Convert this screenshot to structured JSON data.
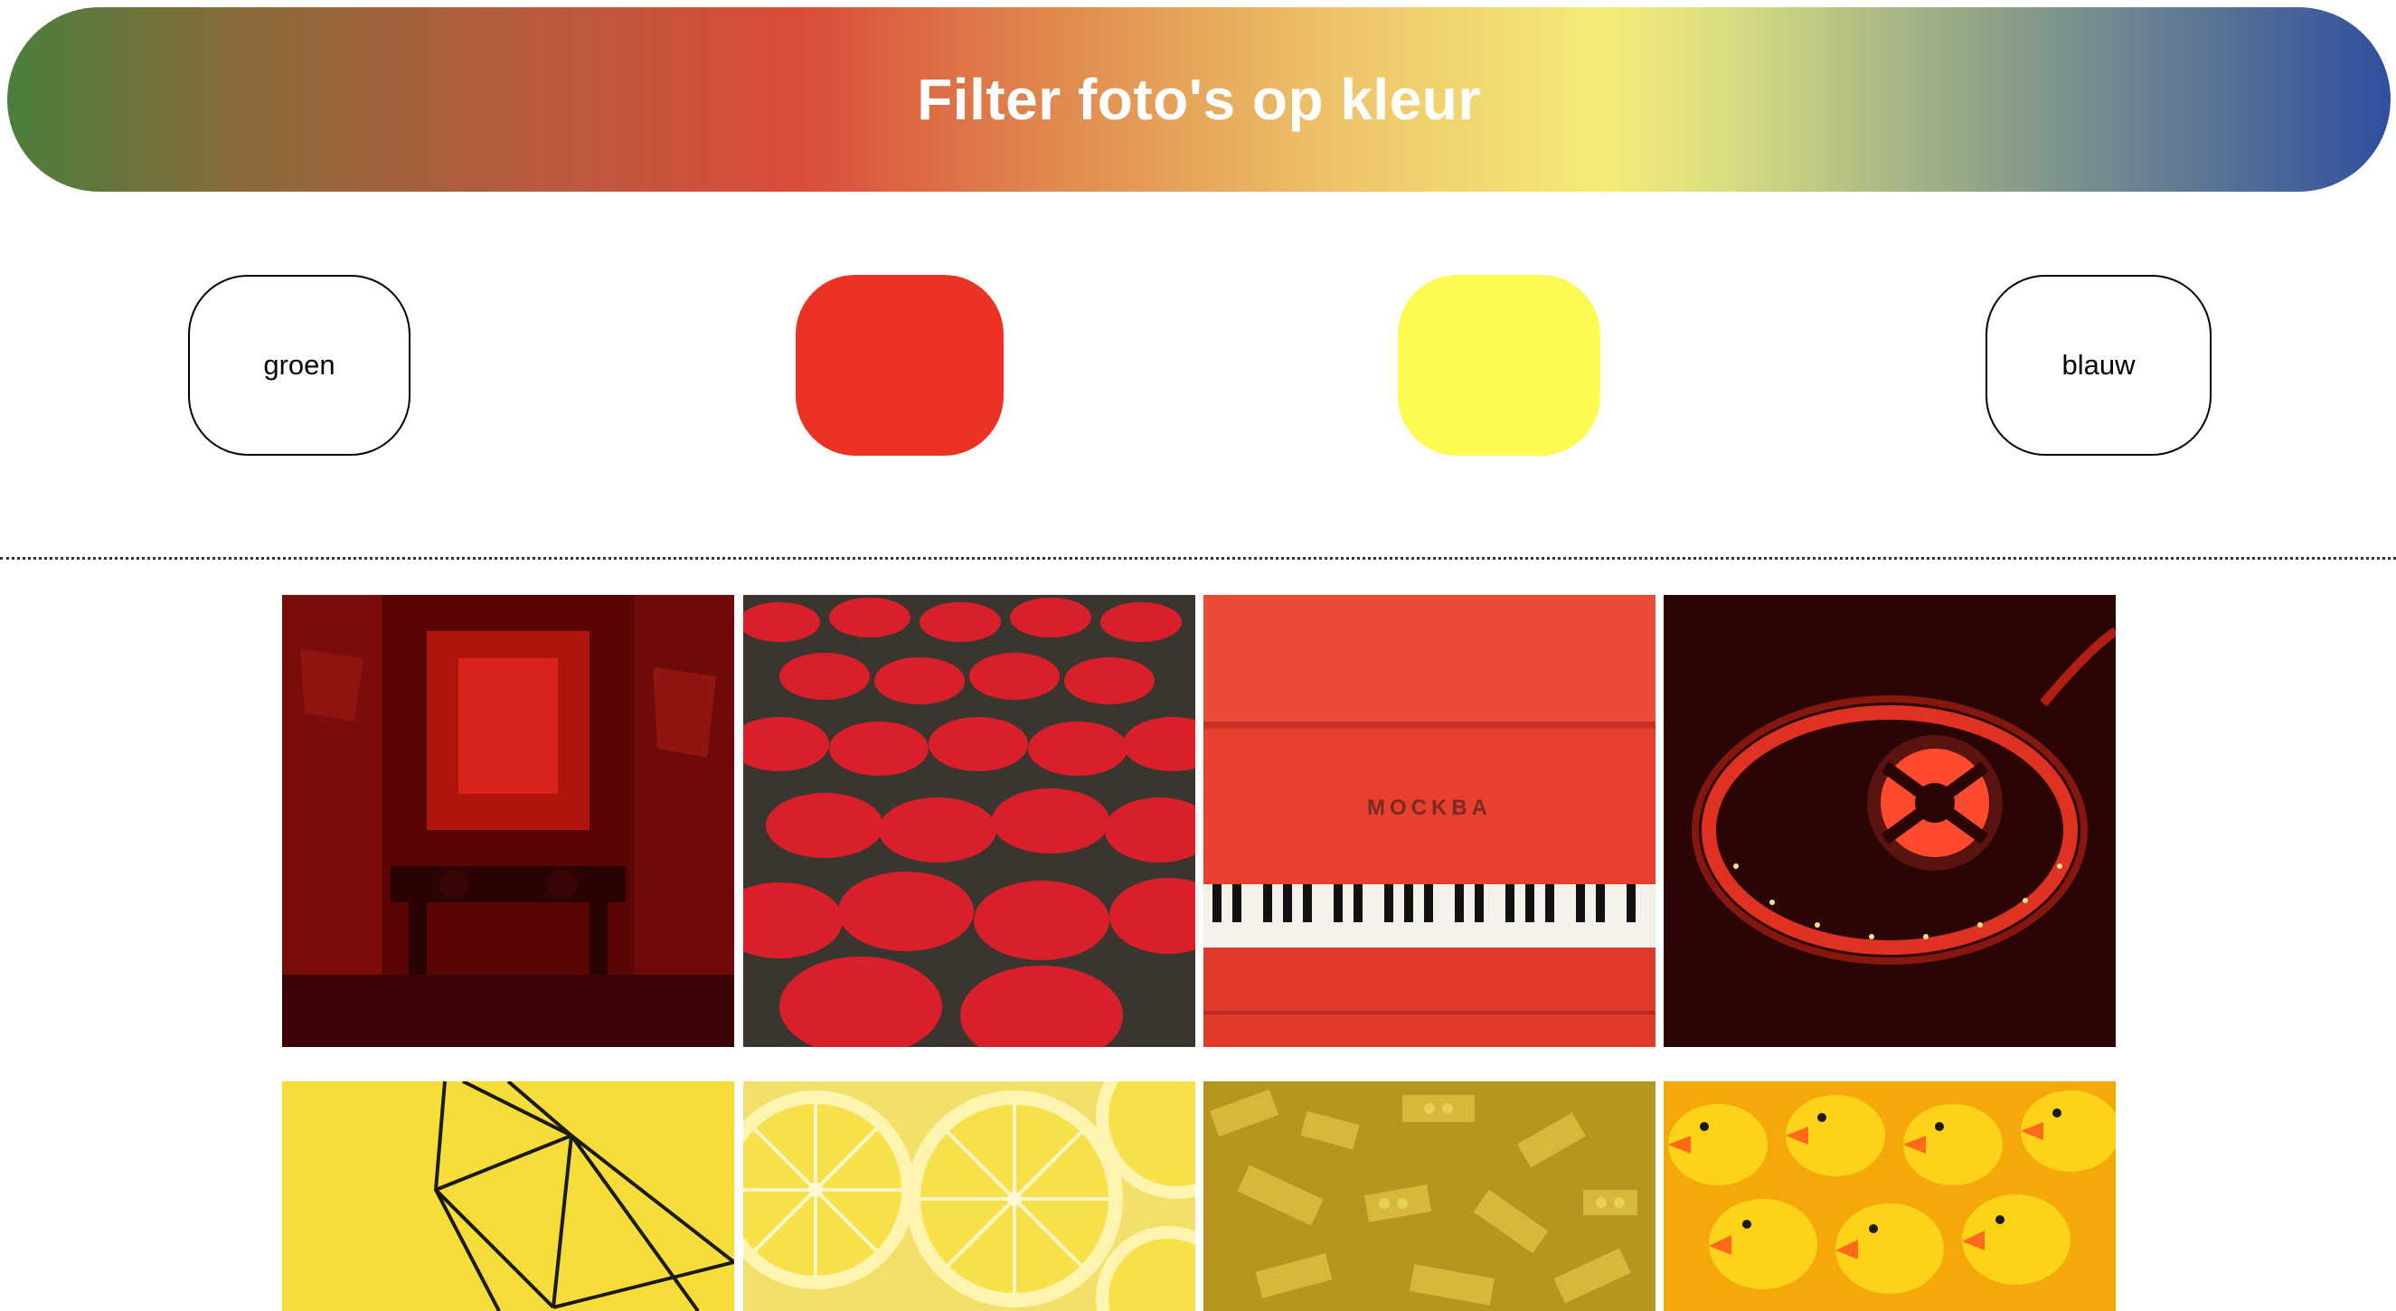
{
  "header": {
    "title": "Filter foto's op kleur"
  },
  "filters": {
    "green": {
      "label": "groen",
      "color": "#ffffff"
    },
    "red": {
      "label": "",
      "color": "#ec3223"
    },
    "yellow": {
      "label": "",
      "color": "#fdfa52"
    },
    "blue": {
      "label": "blauw",
      "color": "#ffffff"
    }
  },
  "gallery": {
    "red_photos": [
      "dj-room",
      "umbrellas",
      "piano",
      "led-strip"
    ],
    "yellow_photos": [
      "wire-geometry",
      "lemon-slices",
      "lego-bricks",
      "rubber-ducks"
    ],
    "piano_brand": "MOCKBA"
  }
}
